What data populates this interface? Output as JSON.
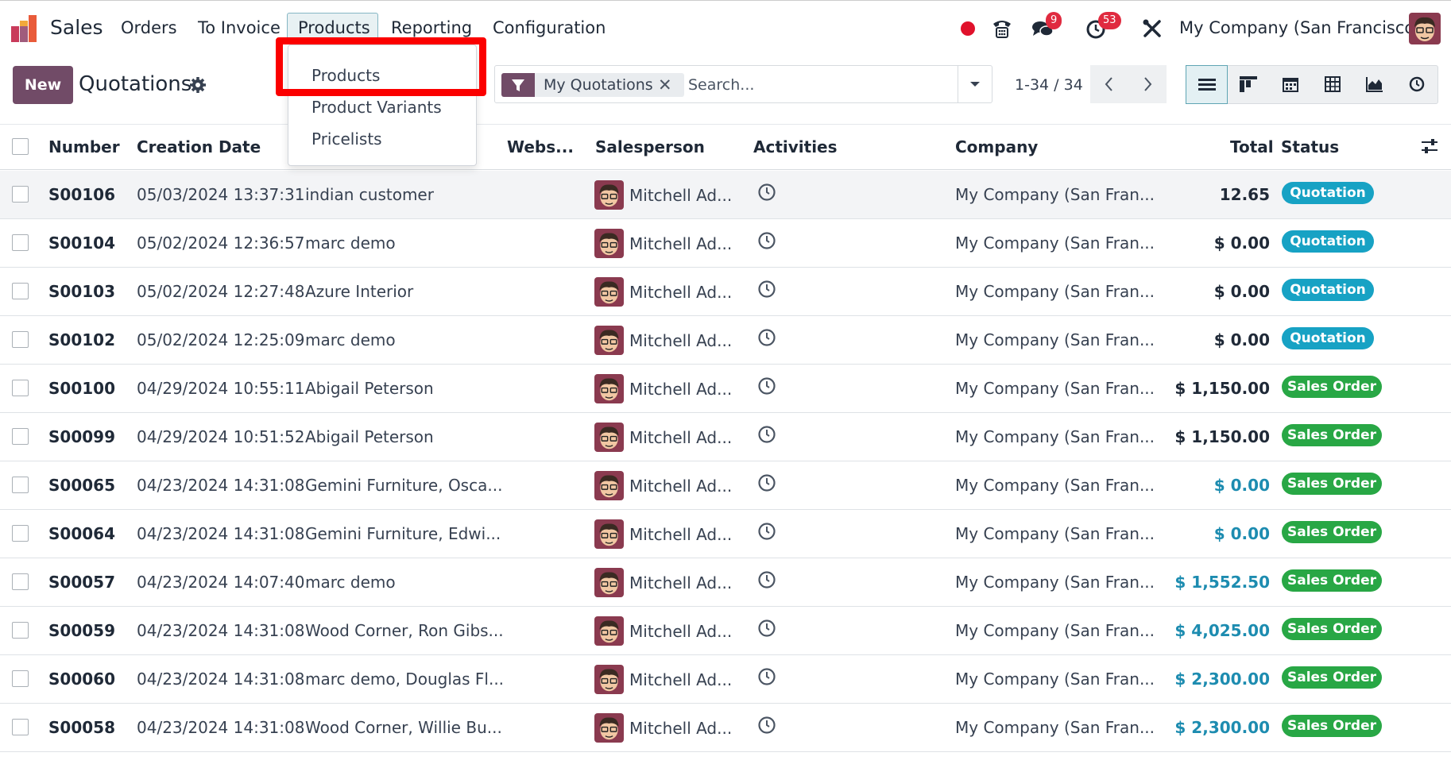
{
  "navbar": {
    "brand": "Sales",
    "menu": [
      "Orders",
      "To Invoice",
      "Products",
      "Reporting",
      "Configuration"
    ],
    "messages_badge": "9",
    "activities_badge": "53",
    "company": "My Company (San Francisco)"
  },
  "dropdown": {
    "items": [
      "Products",
      "Product Variants",
      "Pricelists"
    ]
  },
  "control": {
    "new_label": "New",
    "title": "Quotations",
    "facet": "My Quotations",
    "search_placeholder": "Search...",
    "pager": "1-34 / 34"
  },
  "table": {
    "headers": {
      "number": "Number",
      "creation_date": "Creation Date",
      "website": "Webs...",
      "salesperson": "Salesperson",
      "activities": "Activities",
      "company": "Company",
      "total": "Total",
      "status": "Status"
    },
    "rows": [
      {
        "number": "S00106",
        "date": "05/03/2024 13:37:31",
        "customer": "indian customer",
        "salesperson": "Mitchell Ad...",
        "company": "My Company (San Fran...",
        "total": "12.65",
        "status": "Quotation"
      },
      {
        "number": "S00104",
        "date": "05/02/2024 12:36:57",
        "customer": "marc demo",
        "salesperson": "Mitchell Ad...",
        "company": "My Company (San Fran...",
        "total": "$ 0.00",
        "status": "Quotation"
      },
      {
        "number": "S00103",
        "date": "05/02/2024 12:27:48",
        "customer": "Azure Interior",
        "salesperson": "Mitchell Ad...",
        "company": "My Company (San Fran...",
        "total": "$ 0.00",
        "status": "Quotation"
      },
      {
        "number": "S00102",
        "date": "05/02/2024 12:25:09",
        "customer": "marc demo",
        "salesperson": "Mitchell Ad...",
        "company": "My Company (San Fran...",
        "total": "$ 0.00",
        "status": "Quotation"
      },
      {
        "number": "S00100",
        "date": "04/29/2024 10:55:11",
        "customer": "Abigail Peterson",
        "salesperson": "Mitchell Ad...",
        "company": "My Company (San Fran...",
        "total": "$ 1,150.00",
        "status": "Sales Order"
      },
      {
        "number": "S00099",
        "date": "04/29/2024 10:51:52",
        "customer": "Abigail Peterson",
        "salesperson": "Mitchell Ad...",
        "company": "My Company (San Fran...",
        "total": "$ 1,150.00",
        "status": "Sales Order"
      },
      {
        "number": "S00065",
        "date": "04/23/2024 14:31:08",
        "customer": "Gemini Furniture, Osca...",
        "salesperson": "Mitchell Ad...",
        "company": "My Company (San Fran...",
        "total": "$ 0.00",
        "status": "Sales Order"
      },
      {
        "number": "S00064",
        "date": "04/23/2024 14:31:08",
        "customer": "Gemini Furniture, Edwi...",
        "salesperson": "Mitchell Ad...",
        "company": "My Company (San Fran...",
        "total": "$ 0.00",
        "status": "Sales Order"
      },
      {
        "number": "S00057",
        "date": "04/23/2024 14:07:40",
        "customer": "marc demo",
        "salesperson": "Mitchell Ad...",
        "company": "My Company (San Fran...",
        "total": "$ 1,552.50",
        "status": "Sales Order"
      },
      {
        "number": "S00059",
        "date": "04/23/2024 14:31:08",
        "customer": "Wood Corner, Ron Gibs...",
        "salesperson": "Mitchell Ad...",
        "company": "My Company (San Fran...",
        "total": "$ 4,025.00",
        "status": "Sales Order"
      },
      {
        "number": "S00060",
        "date": "04/23/2024 14:31:08",
        "customer": "marc demo, Douglas Fl...",
        "salesperson": "Mitchell Ad...",
        "company": "My Company (San Fran...",
        "total": "$ 2,300.00",
        "status": "Sales Order"
      },
      {
        "number": "S00058",
        "date": "04/23/2024 14:31:08",
        "customer": "Wood Corner, Willie Bu...",
        "salesperson": "Mitchell Ad...",
        "company": "My Company (San Fran...",
        "total": "$ 2,300.00",
        "status": "Sales Order"
      }
    ]
  },
  "colors": {
    "brand": "#714b67",
    "quotation": "#17a2c4",
    "sales_order": "#28a745",
    "highlight": "#fb0000"
  }
}
